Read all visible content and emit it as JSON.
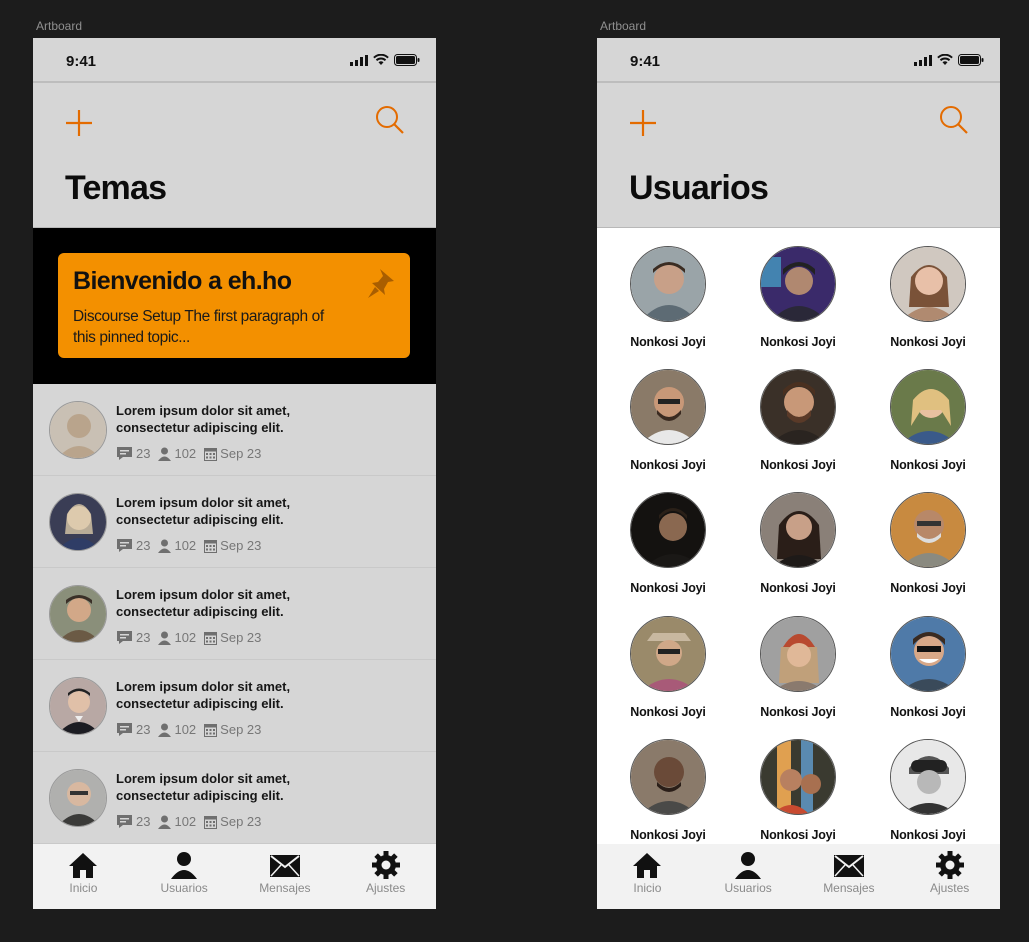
{
  "artboards": [
    {
      "label": "Artboard"
    },
    {
      "label": "Artboard"
    }
  ],
  "status": {
    "time": "9:41"
  },
  "temas": {
    "title": "Temas",
    "pinned": {
      "title": "Bienvenido a eh.ho",
      "text": "Discourse Setup The first paragraph of this pinned topic..."
    },
    "topics": [
      {
        "title": "Lorem ipsum dolor sit amet, consectetur adipiscing elit.",
        "replies": "23",
        "users": "102",
        "date": "Sep 23",
        "avatar_color": "#b9a48c"
      },
      {
        "title": "Lorem ipsum dolor sit amet, consectetur adipiscing elit.",
        "replies": "23",
        "users": "102",
        "date": "Sep 23",
        "avatar_color": "#2f3d66"
      },
      {
        "title": "Lorem ipsum dolor sit amet, consectetur adipiscing elit.",
        "replies": "23",
        "users": "102",
        "date": "Sep 23",
        "avatar_color": "#6b5a45"
      },
      {
        "title": "Lorem ipsum dolor sit amet, consectetur adipiscing elit.",
        "replies": "23",
        "users": "102",
        "date": "Sep 23",
        "avatar_color": "#9c7f7a"
      },
      {
        "title": "Lorem ipsum dolor sit amet, consectetur adipiscing elit.",
        "replies": "23",
        "users": "102",
        "date": "Sep 23",
        "avatar_color": "#8a8a88"
      }
    ]
  },
  "usuarios": {
    "title": "Usuarios",
    "users": [
      {
        "name": "Nonkosi Joyi",
        "color": "#5d6b74"
      },
      {
        "name": "Nonkosi Joyi",
        "color": "#5a3f8f"
      },
      {
        "name": "Nonkosi Joyi",
        "color": "#b08a70"
      },
      {
        "name": "Nonkosi Joyi",
        "color": "#6e5a48"
      },
      {
        "name": "Nonkosi Joyi",
        "color": "#4a3a30"
      },
      {
        "name": "Nonkosi Joyi",
        "color": "#7a8a5a"
      },
      {
        "name": "Nonkosi Joyi",
        "color": "#2a2520"
      },
      {
        "name": "Nonkosi Joyi",
        "color": "#6b5e55"
      },
      {
        "name": "Nonkosi Joyi",
        "color": "#a07a50"
      },
      {
        "name": "Nonkosi Joyi",
        "color": "#7a6a5e"
      },
      {
        "name": "Nonkosi Joyi",
        "color": "#8c5a48"
      },
      {
        "name": "Nonkosi Joyi",
        "color": "#4f7aa8"
      },
      {
        "name": "Nonkosi Joyi",
        "color": "#6a5a50"
      },
      {
        "name": "Nonkosi Joyi",
        "color": "#8a6a3a"
      },
      {
        "name": "Nonkosi Joyi",
        "color": "#9a9a9a"
      }
    ]
  },
  "tabs": [
    {
      "label": "Inicio",
      "icon": "home-icon"
    },
    {
      "label": "Usuarios",
      "icon": "user-icon"
    },
    {
      "label": "Mensajes",
      "icon": "mail-icon"
    },
    {
      "label": "Ajustes",
      "icon": "gear-icon"
    }
  ],
  "colors": {
    "accent": "#f39000",
    "plus": "#e36b00",
    "header_bg": "#d6d6d6"
  }
}
